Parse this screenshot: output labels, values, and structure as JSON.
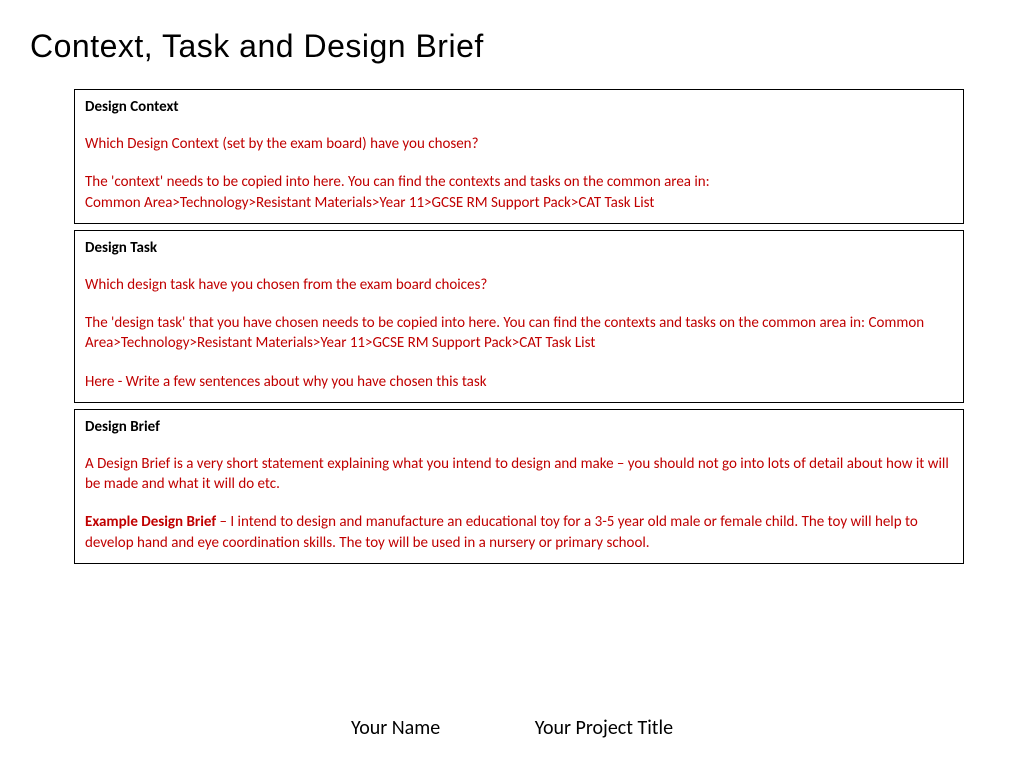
{
  "title": "Context, Task and Design Brief",
  "sections": {
    "context": {
      "heading": "Design Context",
      "question": "Which Design Context (set by the exam board) have you chosen?",
      "instruction1": "The 'context' needs to be copied into here. You can find the contexts and tasks on the common area in:",
      "instruction2": "Common Area>Technology>Resistant Materials>Year 11>GCSE RM Support Pack>CAT Task List"
    },
    "task": {
      "heading": "Design Task",
      "question": "Which design task have you chosen from the exam board choices?",
      "instruction": "The 'design task' that you have chosen needs to be copied into here. You can find the contexts and tasks on the common area in: Common Area>Technology>Resistant Materials>Year 11>GCSE RM Support Pack>CAT Task List",
      "note": "Here - Write a few sentences about why you have chosen this task"
    },
    "brief": {
      "heading": "Design Brief",
      "description": "A Design Brief is a very short statement explaining what you intend to design and make – you should not go into lots of detail about how it will be made and what it will do etc.",
      "example_label": "Example Design Brief",
      "example_body": " – I intend to design and manufacture an educational toy for a 3-5 year old male or female child. The toy will help to develop hand and eye coordination skills.  The toy will be used in a nursery or primary school."
    }
  },
  "footer": {
    "name": "Your Name",
    "project": "Your Project Title"
  }
}
